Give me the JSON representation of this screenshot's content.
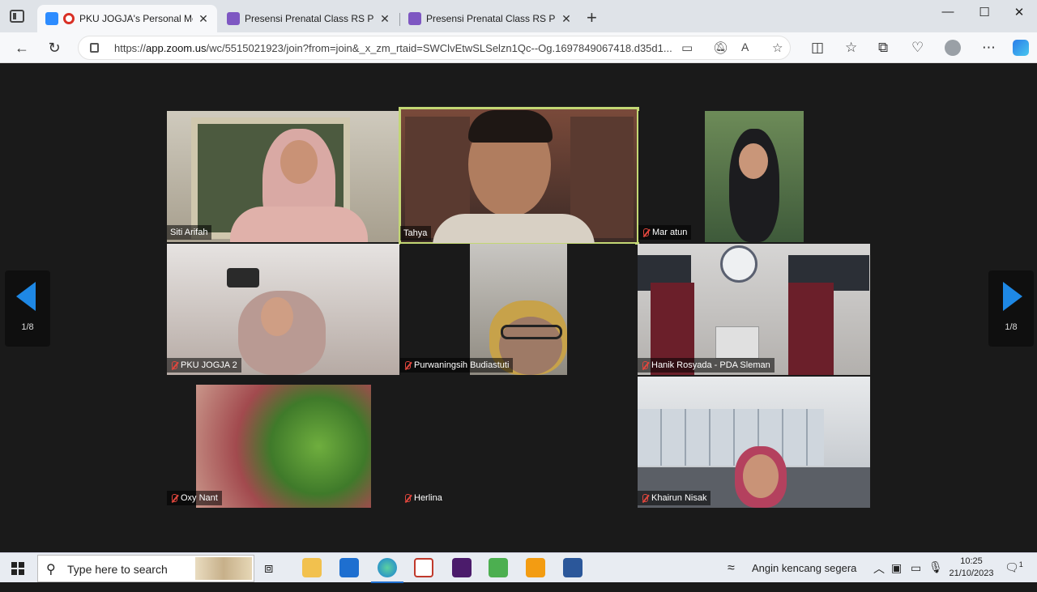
{
  "browser": {
    "tabs": [
      {
        "title": "PKU JOGJA's Personal Meeting Room",
        "icon": "zoom-icon",
        "color": "#2d8cff",
        "active": true
      },
      {
        "title": "Presensi Prenatal Class RS PKU Muhammadiyah",
        "icon": "forms-icon",
        "color": "#7e57c2",
        "active": false
      },
      {
        "title": "Presensi Prenatal Class RS PKU Muhammadiyah",
        "icon": "forms-icon",
        "color": "#7e57c2",
        "active": false
      }
    ],
    "url_prefix": "https://",
    "url_host": "app.zoom.us",
    "url_rest": "/wc/5515021923/join?from=join&_x_zm_rtaid=SWClvEtwSLSelzn1Qc--Og.1697849067418.d35d1..."
  },
  "meeting": {
    "participants": [
      {
        "name": "Siti Arifah",
        "muted": false,
        "speaking": false
      },
      {
        "name": "Tahya",
        "muted": false,
        "speaking": true
      },
      {
        "name": "Mar atun",
        "muted": true,
        "speaking": false
      },
      {
        "name": "PKU JOGJA 2",
        "muted": true,
        "speaking": false
      },
      {
        "name": "Purwaningsih Budiastuti",
        "muted": true,
        "speaking": false
      },
      {
        "name": "Hanik Rosyada - PDA Sleman",
        "muted": true,
        "speaking": false
      },
      {
        "name": "Oxy Nant",
        "muted": true,
        "speaking": false
      },
      {
        "name": "Herlina",
        "muted": true,
        "speaking": false
      },
      {
        "name": "Khairun Nisak",
        "muted": true,
        "speaking": false
      }
    ],
    "page_left": "1/8",
    "page_right": "1/8",
    "accent": "#c3d774",
    "arrow_color": "#1e88e5"
  },
  "taskbar": {
    "search_placeholder": "Type here to search",
    "weather": "Angin kencang segera",
    "time": "10:25",
    "date": "21/10/2023",
    "notification_count": "1"
  }
}
